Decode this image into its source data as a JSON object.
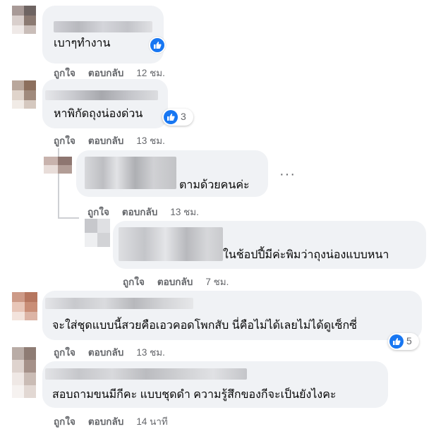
{
  "actions": {
    "like": "ถูกใจ",
    "reply": "ตอบกลับ"
  },
  "icons": {
    "like": "thumbs-up-icon",
    "more": "more-options-icon"
  },
  "colors": {
    "bubble": "#f0f2f5",
    "like_blue": "#1877f2",
    "meta_gray": "#65676b"
  },
  "comments": [
    {
      "text": "เบาๆทำงาน",
      "time": "12 ชม."
    },
    {
      "text": "หาพิกัดถุงน่องด่วน",
      "time": "13 ชม.",
      "reactions": "3"
    },
    {
      "text": "ตามด้วยคนค่ะ",
      "time": "13 ชม.",
      "more": "···"
    },
    {
      "text": "ในช้อปปี้มีค่ะพิมว่าถุงน่องแบบหนา",
      "time": "7 ชม."
    },
    {
      "text": "จะใส่ชุดแบบนี้สวยคือเอวคอดโพกสับ นี่คือไม่ได้เลยไม่ได้ดูเซ็กซี่",
      "time": "13 ชม.",
      "reactions": "5"
    },
    {
      "text": "สอบถามขนมีกีคะ แบบชุดดำ ความรู้สึกของกีจะเป็นยังไงคะ",
      "time": "14 นาที"
    }
  ]
}
